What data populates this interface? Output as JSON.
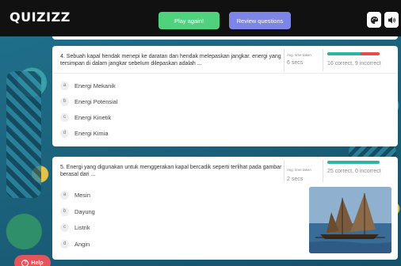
{
  "header": {
    "logo": "QUIZIZZ",
    "play_again": "Play again!",
    "review_questions": "Review questions",
    "icons": [
      "theme-icon",
      "sound-icon"
    ]
  },
  "questions": [
    {
      "text": "4. Sebuah kapal hendak menepi ke daratan dan hendak melepaskan jangkar. energi yang tersimpan di dalam jangkar sebelum dilepaskan adalah ...",
      "avg_label": "Avg. time taken",
      "avg_value": "6 secs",
      "stats": "16 correct, 9 incorrect",
      "correct_fraction": 0.64,
      "options": [
        {
          "letter": "a",
          "text": "Energi Mekanik"
        },
        {
          "letter": "b",
          "text": "Energi Potensial"
        },
        {
          "letter": "c",
          "text": "Energi Kinetik"
        },
        {
          "letter": "d",
          "text": "Energi Kimia"
        }
      ]
    },
    {
      "text": "5. Energi yang digunakan untuk menggerakan kapal bercadik seperti terlihat pada gambar berasal dari ...",
      "avg_label": "Avg. time taken",
      "avg_value": "2 secs",
      "stats": "25 correct, 0 incorrect",
      "correct_fraction": 1.0,
      "options": [
        {
          "letter": "a",
          "text": "Mesin"
        },
        {
          "letter": "b",
          "text": "Dayung"
        },
        {
          "letter": "c",
          "text": "Listrik"
        },
        {
          "letter": "d",
          "text": "Angin"
        }
      ]
    }
  ],
  "help": {
    "label": "Help",
    "icon": "help-icon"
  },
  "colors": {
    "play": "#4fd17e",
    "review": "#7d86e6",
    "correct": "#2bb6a3",
    "incorrect": "#e74c4c",
    "help": "#e2565b"
  }
}
